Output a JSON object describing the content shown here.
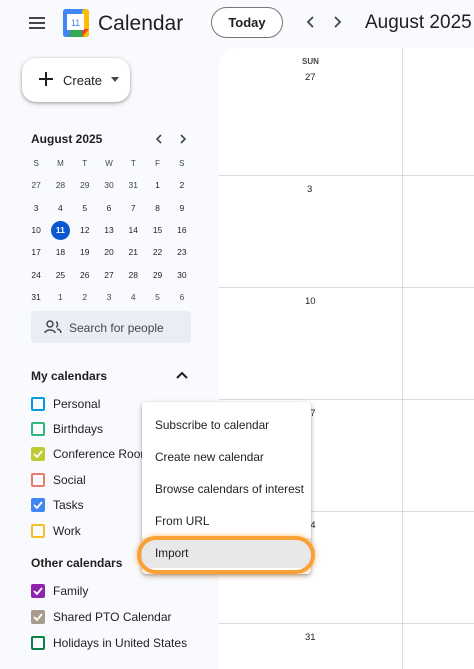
{
  "header": {
    "app_title": "Calendar",
    "logo_number": "11",
    "today_label": "Today",
    "month_title": "August 2025"
  },
  "sidebar": {
    "create_label": "Create",
    "mini_calendar": {
      "title": "August 2025",
      "weekdays": [
        "S",
        "M",
        "T",
        "W",
        "T",
        "F",
        "S"
      ],
      "weeks": [
        [
          "27",
          "28",
          "29",
          "30",
          "31",
          "1",
          "2"
        ],
        [
          "3",
          "4",
          "5",
          "6",
          "7",
          "8",
          "9"
        ],
        [
          "10",
          "11",
          "12",
          "13",
          "14",
          "15",
          "16"
        ],
        [
          "17",
          "18",
          "19",
          "20",
          "21",
          "22",
          "23"
        ],
        [
          "24",
          "25",
          "26",
          "27",
          "28",
          "29",
          "30"
        ],
        [
          "31",
          "1",
          "2",
          "3",
          "4",
          "5",
          "6"
        ]
      ],
      "today": "11"
    },
    "search_people_placeholder": "Search for people",
    "my_calendars_title": "My calendars",
    "my_calendars": [
      {
        "label": "Personal",
        "color": "#039be5",
        "checked": false
      },
      {
        "label": "Birthdays",
        "color": "#33b679",
        "checked": false
      },
      {
        "label": "Conference Room",
        "color": "#c0ca33",
        "checked": true
      },
      {
        "label": "Social",
        "color": "#e67c73",
        "checked": false
      },
      {
        "label": "Tasks",
        "color": "#4285f4",
        "checked": true
      },
      {
        "label": "Work",
        "color": "#f6bf26",
        "checked": false
      }
    ],
    "other_calendars_title": "Other calendars",
    "other_calendars": [
      {
        "label": "Family",
        "color": "#8e24aa",
        "checked": true
      },
      {
        "label": "Shared PTO Calendar",
        "color": "#a79b8e",
        "checked": true
      },
      {
        "label": "Holidays in United States",
        "color": "#0b8043",
        "checked": false
      }
    ]
  },
  "main": {
    "day_of_week": "SUN",
    "week_start_dates": [
      "27",
      "3",
      "10",
      "17",
      "24",
      "31"
    ]
  },
  "context_menu": {
    "items": [
      {
        "label": "Subscribe to calendar"
      },
      {
        "label": "Create new calendar"
      },
      {
        "label": "Browse calendars of interest"
      },
      {
        "label": "From URL"
      },
      {
        "label": "Import",
        "highlighted": true
      }
    ]
  },
  "colors": {
    "accent": "#0b57d0",
    "highlight_ring": "#f9a036"
  }
}
